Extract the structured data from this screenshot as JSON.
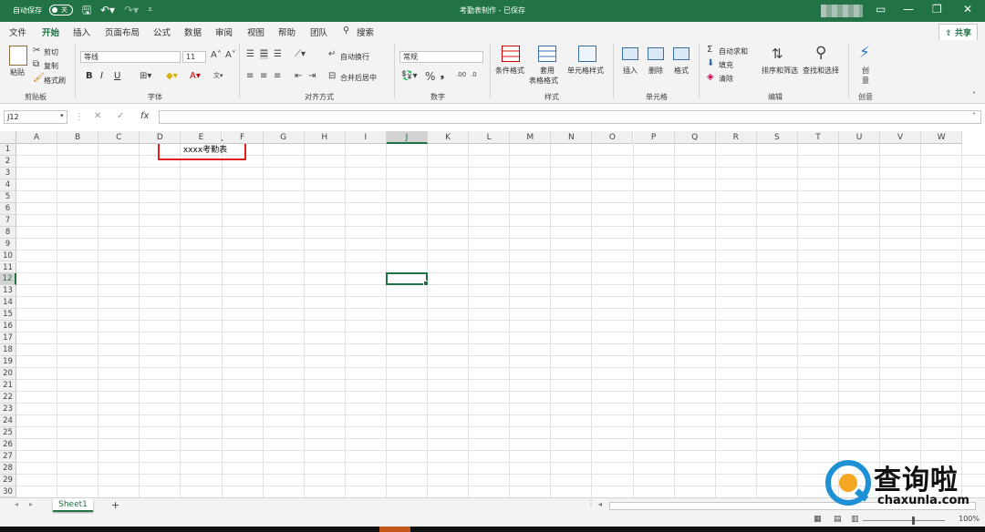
{
  "titlebar": {
    "autosave_label": "自动保存",
    "autosave_state": "关",
    "title": "考勤表制作 - 已保存",
    "colors": {
      "brand": "#217346"
    }
  },
  "menu": {
    "tabs": [
      "文件",
      "开始",
      "插入",
      "页面布局",
      "公式",
      "数据",
      "审阅",
      "视图",
      "帮助",
      "团队"
    ],
    "active": "开始",
    "search": "搜索",
    "share": "共享"
  },
  "ribbon": {
    "clipboard": {
      "paste": "粘贴",
      "cut": "剪切",
      "copy": "复制",
      "format_painter": "格式刷",
      "label": "剪贴板"
    },
    "font": {
      "name": "等线",
      "size": "11",
      "label": "字体",
      "bold": "B",
      "italic": "I",
      "underline": "U"
    },
    "alignment": {
      "wrap": "自动换行",
      "merge": "合并后居中",
      "label": "对齐方式"
    },
    "number": {
      "format": "常规",
      "label": "数字"
    },
    "styles": {
      "conditional": "条件格式",
      "table_fmt_1": "套用",
      "table_fmt_2": "表格格式",
      "cell_styles": "单元格样式",
      "label": "样式"
    },
    "cells": {
      "insert": "插入",
      "delete": "删除",
      "format": "格式",
      "label": "单元格"
    },
    "editing": {
      "autosum": "自动求和",
      "fill": "填充",
      "clear": "清除",
      "sort_filter": "排序和筛选",
      "find_select": "查找和选择",
      "label": "编辑"
    },
    "creativity": {
      "idea_1": "创",
      "idea_2": "意",
      "label": "创意"
    }
  },
  "formula_bar": {
    "name_box": "J12",
    "fx": "fx",
    "content": ""
  },
  "grid": {
    "columns": [
      "A",
      "B",
      "C",
      "D",
      "E",
      "F",
      "G",
      "H",
      "I",
      "J",
      "K",
      "L",
      "M",
      "N",
      "O",
      "P",
      "Q",
      "R",
      "S",
      "T",
      "U",
      "V",
      "W"
    ],
    "rows": 30,
    "selected_cell": "J12",
    "cells": [
      {
        "ref": "E1",
        "value": "xxxx考勤表"
      }
    ]
  },
  "sheets": {
    "tabs": [
      "Sheet1"
    ],
    "active": "Sheet1",
    "add": "+"
  },
  "status": {
    "zoom": "100%"
  },
  "watermark": {
    "text": "查询啦",
    "url": "chaxunla.com"
  }
}
